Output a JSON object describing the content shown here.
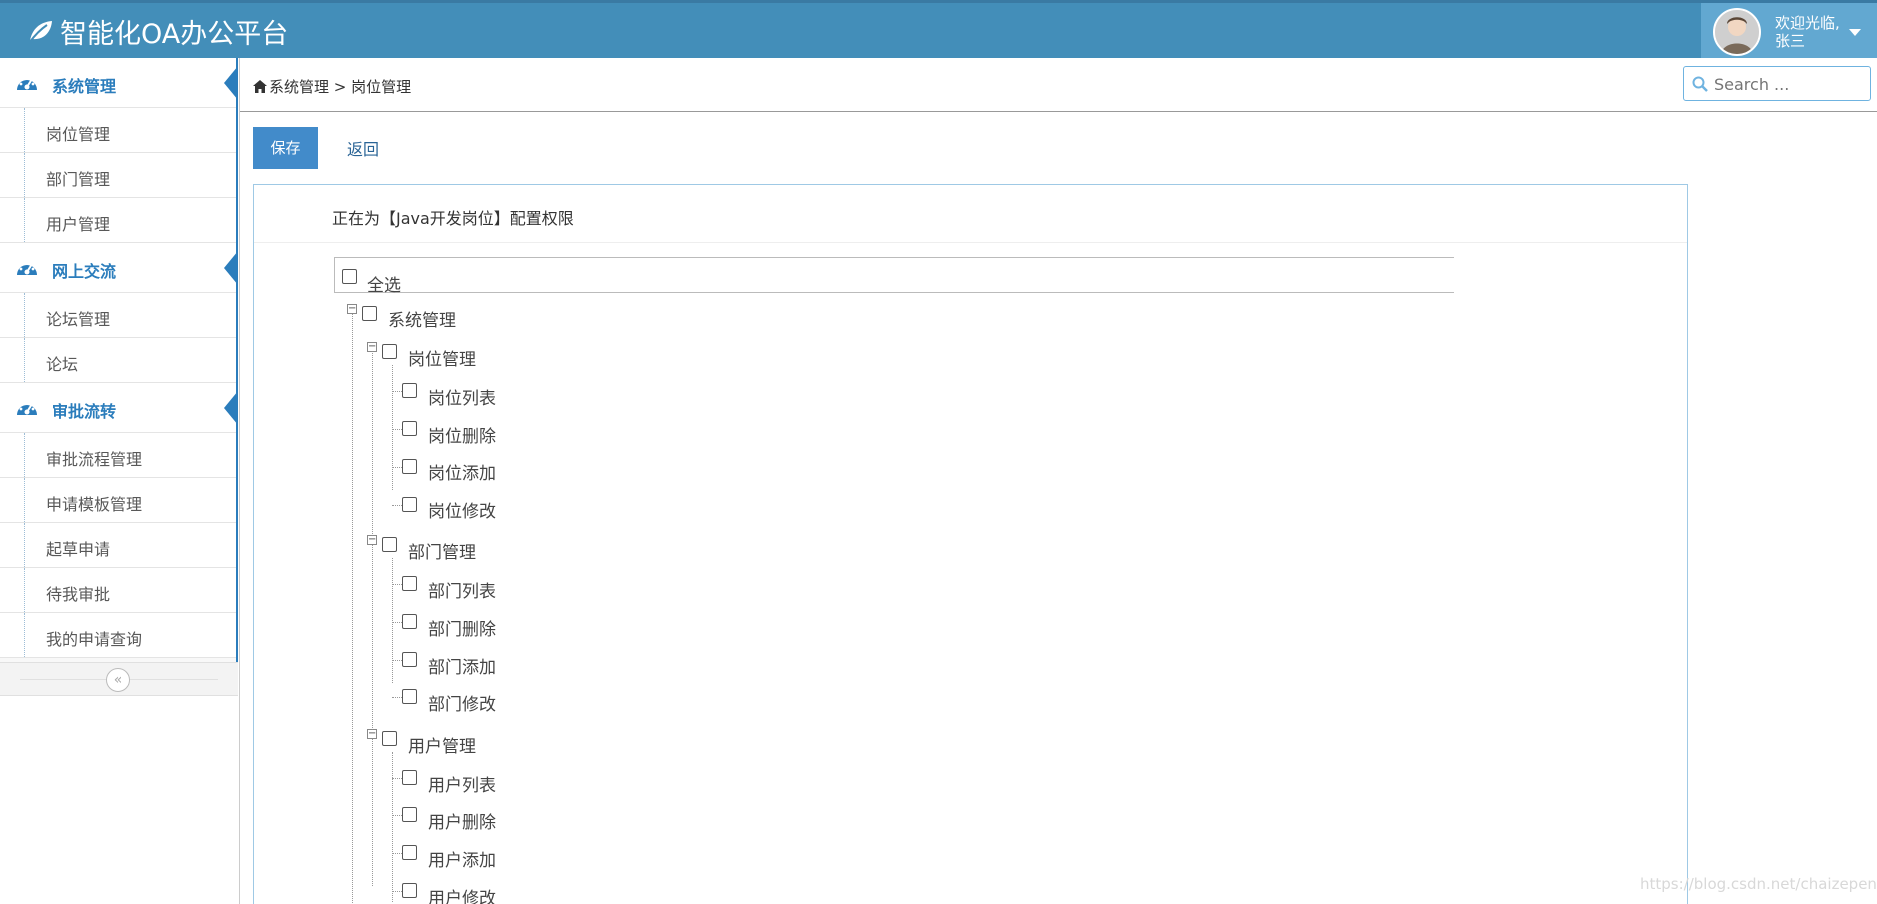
{
  "app": {
    "title": "智能化OA办公平台",
    "brand_color": "#438eb9",
    "user_box_color": "#62a8d1"
  },
  "user": {
    "greeting": "欢迎光临,",
    "name": "张三"
  },
  "sidebar": {
    "sections": [
      {
        "label": "系统管理",
        "icon": "dashboard-icon",
        "items": [
          {
            "label": "岗位管理"
          },
          {
            "label": "部门管理"
          },
          {
            "label": "用户管理"
          }
        ]
      },
      {
        "label": "网上交流",
        "icon": "dashboard-icon",
        "items": [
          {
            "label": "论坛管理"
          },
          {
            "label": "论坛"
          }
        ]
      },
      {
        "label": "审批流转",
        "icon": "dashboard-icon",
        "items": [
          {
            "label": "审批流程管理"
          },
          {
            "label": "申请模板管理"
          },
          {
            "label": "起草申请"
          },
          {
            "label": "待我审批"
          },
          {
            "label": "我的申请查询"
          }
        ]
      }
    ],
    "collapse_icon": "double-chevron-left-icon",
    "collapse_glyph": "«"
  },
  "breadcrumb": {
    "home_icon": "home-icon",
    "text": "系统管理 > 岗位管理"
  },
  "search": {
    "placeholder": "Search ..."
  },
  "actions": {
    "save_label": "保存",
    "back_label": "返回"
  },
  "panel": {
    "title": "正在为【Java开发岗位】配置权限"
  },
  "tree": {
    "select_all": "全选",
    "root": "系统管理",
    "groups": [
      {
        "label": "岗位管理",
        "items": [
          "岗位列表",
          "岗位删除",
          "岗位添加",
          "岗位修改"
        ]
      },
      {
        "label": "部门管理",
        "items": [
          "部门列表",
          "部门删除",
          "部门添加",
          "部门修改"
        ]
      },
      {
        "label": "用户管理",
        "items": [
          "用户列表",
          "用户删除",
          "用户添加",
          "用户修改"
        ]
      }
    ]
  },
  "watermark": "https://blog.csdn.net/chaizepeng"
}
